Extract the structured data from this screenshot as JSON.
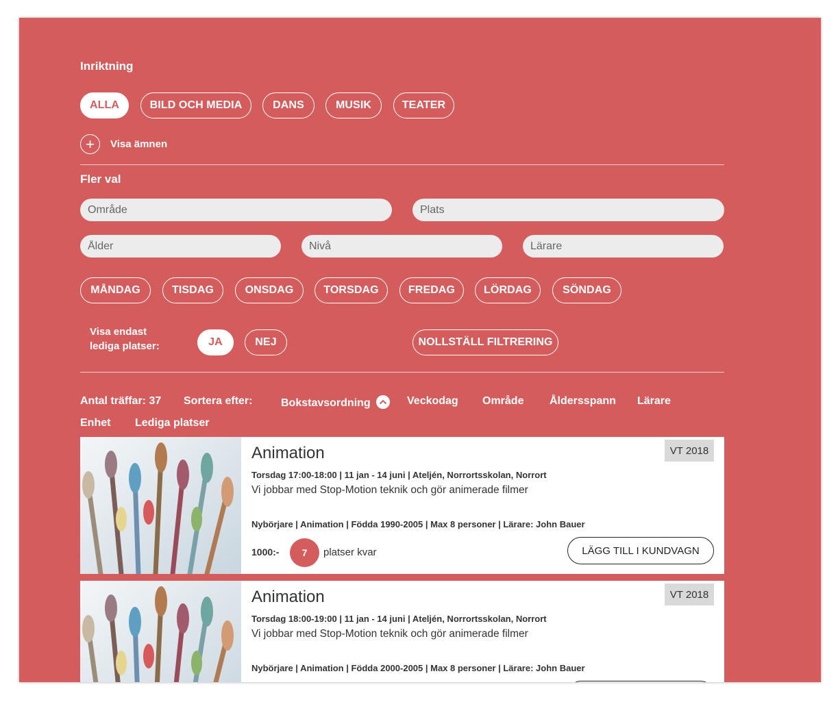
{
  "filters": {
    "inriktning_title": "Inriktning",
    "categories": [
      "ALLA",
      "BILD OCH MEDIA",
      "DANS",
      "MUSIK",
      "TEATER"
    ],
    "show_subjects": "Visa ämnen",
    "more_title": "Fler val",
    "placeholders": {
      "omrade": "Område",
      "plats": "Plats",
      "alder": "Ålder",
      "niva": "Nivå",
      "larare": "Lärare"
    },
    "days": [
      "MÅNDAG",
      "TISDAG",
      "ONSDAG",
      "TORSDAG",
      "FREDAG",
      "LÖRDAG",
      "SÖNDAG"
    ],
    "available_label_1": "Visa endast",
    "available_label_2": "lediga platser:",
    "yes": "JA",
    "no": "NEJ",
    "reset": "NOLLSTÄLL FILTRERING"
  },
  "results": {
    "count_label": "Antal träffar: 37",
    "sort_label": "Sortera efter:",
    "sort_options": [
      "Bokstavsordning",
      "Veckodag",
      "Område",
      "Åldersspann",
      "Lärare",
      "Enhet",
      "Lediga platser"
    ],
    "active_sort": "Bokstavsordning"
  },
  "courses": [
    {
      "title": "Animation",
      "term": "VT 2018",
      "meta": "Torsdag 17:00-18:00 | 11 jan - 14 juni | Ateljén, Norrortsskolan, Norrort",
      "description": "Vi jobbar med Stop-Motion teknik och gör animerade filmer",
      "details": "Nybörjare | Animation | Födda 1990-2005 | Max 8 personer | Lärare: John Bauer",
      "price": "1000:-",
      "seats": "7",
      "seats_text": "platser kvar",
      "cart_label": "LÄGG TILL I KUNDVAGN"
    },
    {
      "title": "Animation",
      "term": "VT 2018",
      "meta": "Torsdag 18:00-19:00 | 11 jan - 14 juni | Ateljén, Norrortsskolan, Norrort",
      "description": "Vi jobbar med Stop-Motion teknik och gör animerade filmer",
      "details": "Nybörjare | Animation | Födda 2000-2005 | Max 8 personer | Lärare: John Bauer"
    }
  ],
  "colors": {
    "accent": "#d55c5d",
    "field_bg": "#ececec",
    "term_bg": "#d9d9d9"
  }
}
